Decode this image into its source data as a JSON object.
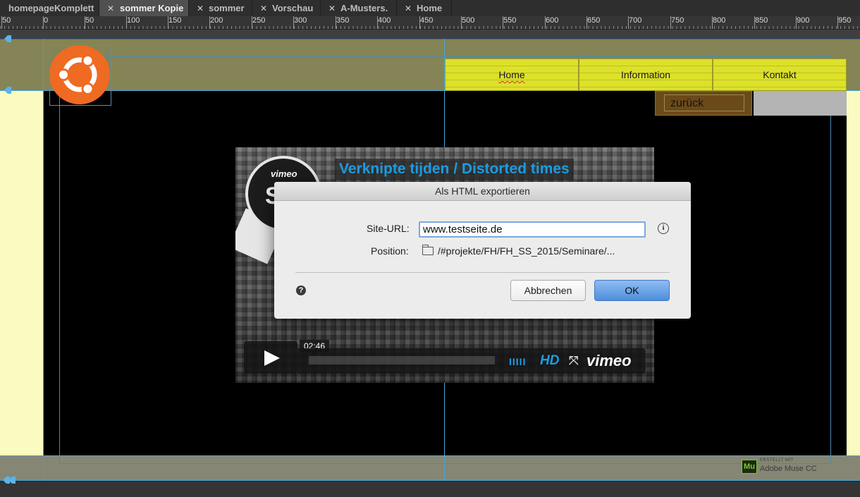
{
  "tabs": [
    {
      "label": "homepageKomplett",
      "active": false,
      "closable": false
    },
    {
      "label": "sommer Kopie",
      "active": true,
      "closable": true
    },
    {
      "label": "sommer",
      "active": false,
      "closable": true
    },
    {
      "label": "Vorschau",
      "active": false,
      "closable": true
    },
    {
      "label": "A-Musters.",
      "active": false,
      "closable": true
    },
    {
      "label": "Home",
      "active": false,
      "closable": true
    }
  ],
  "ruler": [
    "50",
    "0",
    "50",
    "100",
    "150",
    "200",
    "250",
    "300",
    "350",
    "400",
    "450",
    "500",
    "550",
    "600",
    "650",
    "700",
    "750",
    "800",
    "850",
    "900",
    "950"
  ],
  "site": {
    "logo_icon": "ubuntu-logo-icon",
    "nav": [
      "Home",
      "Information",
      "Kontakt"
    ],
    "back_label": "zurück"
  },
  "video": {
    "title": "Verknipte tijden / Distorted times",
    "seal_brand": "vimeo",
    "seal_text": "STAFF",
    "time": "02:46",
    "volume_bars": "IIIII",
    "hd": "HD",
    "fullscreen_icon": "fullscreen-icon",
    "brand": "vimeo"
  },
  "dialog": {
    "title": "Als HTML exportieren",
    "site_url_label": "Site-URL:",
    "site_url_value": "www.testseite.de",
    "position_label": "Position:",
    "position_value": "/#projekte/FH/FH_SS_2015/Seminare/...",
    "cancel_label": "Abbrechen",
    "ok_label": "OK"
  },
  "footer": {
    "badge_small": "ERSTELLT MIT",
    "badge_name": "Adobe Muse CC",
    "badge_icon": "Mu"
  },
  "colors": {
    "accent": "#1d9de3",
    "nav_yellow": "#dde129",
    "header_olive": "#848456",
    "logo_orange": "#ef6a23"
  }
}
